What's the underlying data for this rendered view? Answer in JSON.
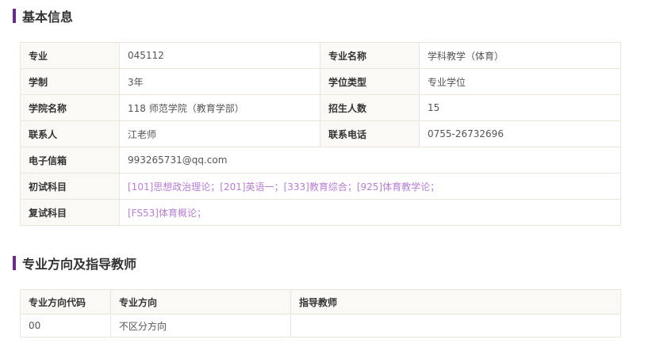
{
  "section1": {
    "title": "基本信息"
  },
  "info": {
    "major_label": "专业",
    "major_value": "045112",
    "major_name_label": "专业名称",
    "major_name_value": "学科教学（体育）",
    "duration_label": "学制",
    "duration_value": "3年",
    "degree_type_label": "学位类型",
    "degree_type_value": "专业学位",
    "college_label": "学院名称",
    "college_value": "118 师范学院（教育学部）",
    "enroll_label": "招生人数",
    "enroll_value": "15",
    "contact_label": "联系人",
    "contact_value": "江老师",
    "phone_label": "联系电话",
    "phone_value": "0755-26732696",
    "email_label": "电子信箱",
    "email_value": "993265731@qq.com",
    "prelim_label": "初试科目",
    "prelim_subjects": [
      "[101]思想政治理论；",
      "[201]英语一；",
      "[333]教育综合；",
      "[925]体育教学论；"
    ],
    "retest_label": "复试科目",
    "retest_subjects": [
      "[FS53]体育概论；"
    ]
  },
  "section2": {
    "title": "专业方向及指导教师"
  },
  "directions": {
    "headers": [
      "专业方向代码",
      "专业方向",
      "指导教师"
    ],
    "rows": [
      {
        "code": "00",
        "direction": "不区分方向",
        "advisor": ""
      }
    ]
  },
  "colors": {
    "accent": "#6b2b8f",
    "link": "#b77dd6",
    "border": "#ece5dc"
  }
}
